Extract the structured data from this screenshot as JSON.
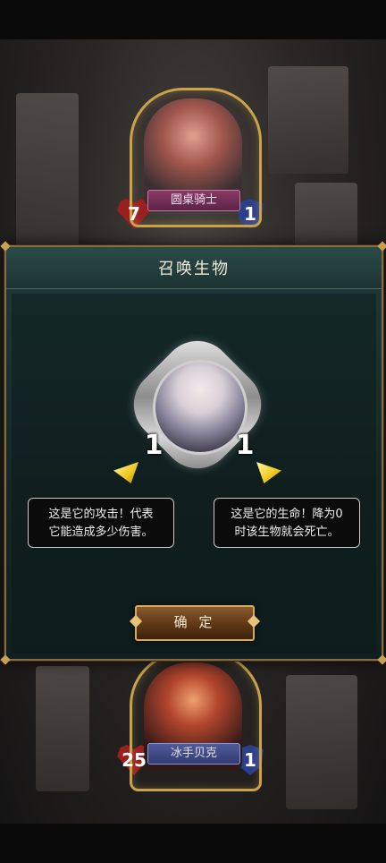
{
  "opponent": {
    "name": "圆桌骑士",
    "attack": "7",
    "defense": "1"
  },
  "player": {
    "name": "冰手贝克",
    "attack": "25",
    "defense": "1"
  },
  "dialog": {
    "title": "召唤生物",
    "creature": {
      "attack": "1",
      "health": "1"
    },
    "tip_attack": [
      "这是它的攻击！代表",
      "它能造成多少伤害。"
    ],
    "tip_health": [
      "这是它的生命！降为0",
      "时该生物就会死亡。"
    ],
    "confirm_label": "确 定"
  },
  "colors": {
    "dialog_bg": "#1e3a3b",
    "dialog_border": "#8a6a3e",
    "arrow": "#f0c81c",
    "button": "#5a3414"
  },
  "icons": [
    "heart-attack-icon",
    "shield-defense-icon",
    "sword-attack-icon",
    "arrow-pointer-icon"
  ]
}
